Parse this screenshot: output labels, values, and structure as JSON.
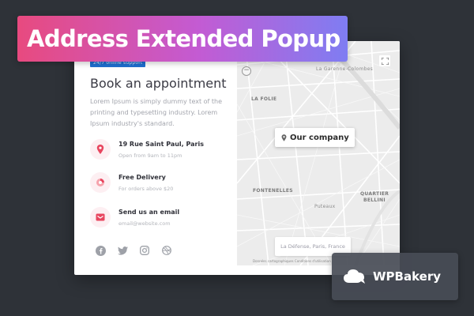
{
  "banner": {
    "title": "Address Extended Popup"
  },
  "card": {
    "support_tag": "24/7 online support",
    "title": "Book an appointment",
    "description": "Lorem Ipsum is simply dummy text of the printing and typesetting industry. Lorem Ipsum industry's standard.",
    "contacts": [
      {
        "label": "19 Rue Saint Paul, Paris",
        "sub": "Open from 9am to 11pm",
        "icon": "location-pin-icon"
      },
      {
        "label": "Free Delivery",
        "sub": "For orders above $20",
        "icon": "delivery-icon"
      },
      {
        "label": "Send us an email",
        "sub": "email@website.com",
        "icon": "email-icon"
      }
    ],
    "socials": [
      "facebook-icon",
      "twitter-icon",
      "instagram-icon",
      "dribbble-icon"
    ],
    "accent_color": "#e8465f"
  },
  "map": {
    "places": {
      "la_garenne": "La Garenne-Colombes",
      "la_folie": "LA FOLIE",
      "fontenelles": "FONTENELLES",
      "quartier_bellini_1": "QUARTIER",
      "quartier_bellini_2": "BELLINI",
      "puteaux": "Puteaux"
    },
    "marker_label": "Our company",
    "address_box": "La Défense, Paris, France",
    "zoom_symbol": "−",
    "attribution": "Données cartographiques   Conditions d'utilisation"
  },
  "badge": {
    "brand": "WPBakery",
    "icon": "cloud-icon"
  }
}
